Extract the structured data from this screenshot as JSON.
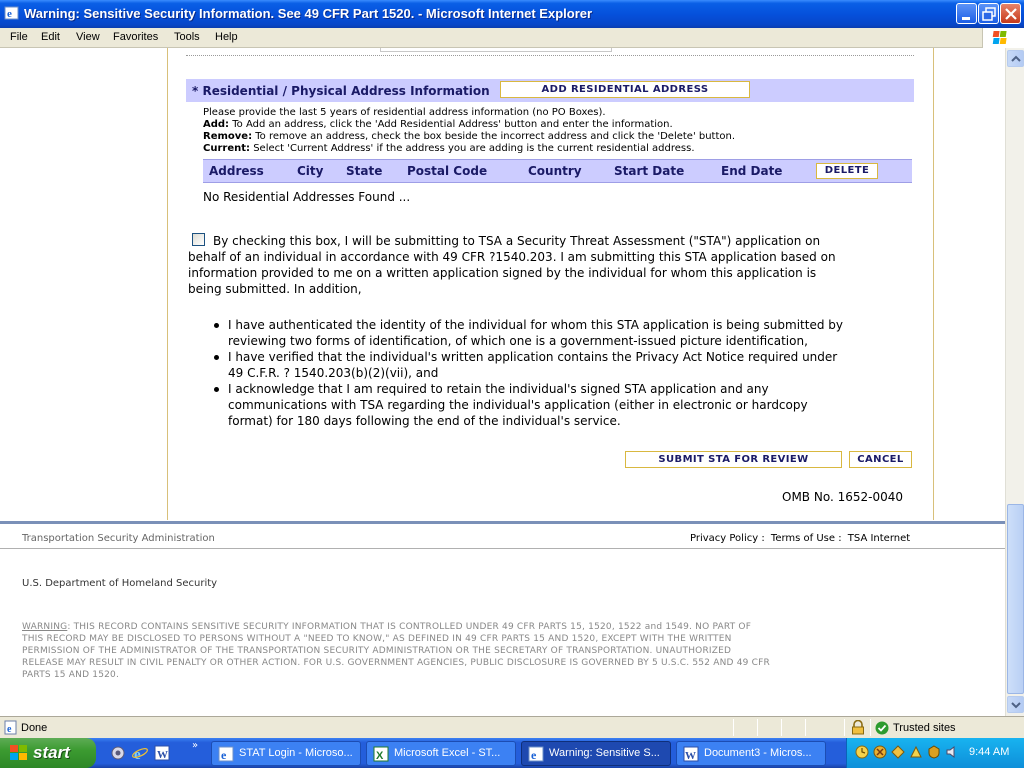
{
  "window": {
    "title": "Warning: Sensitive Security Information. See 49 CFR Part 1520. - Microsoft Internet Explorer"
  },
  "menu": [
    "File",
    "Edit",
    "View",
    "Favorites",
    "Tools",
    "Help"
  ],
  "section": {
    "title": "* Residential / Physical Address Information",
    "add_button": "ADD RESIDENTIAL ADDRESS"
  },
  "instructions": {
    "intro": "Please provide the last 5 years of residential address information (no PO Boxes).",
    "add_label": "Add:",
    "add_text": " To Add an address, click the 'Add Residential Address' button and enter the information.",
    "remove_label": "Remove:",
    "remove_text": " To remove an address, check the box beside the incorrect address and click the 'Delete' button.",
    "current_label": "Current:",
    "current_text": " Select 'Current Address' if the address you are adding is the current residential address."
  },
  "table": {
    "columns": [
      "Address",
      "City",
      "State",
      "Postal Code",
      "Country",
      "Start Date",
      "End Date"
    ],
    "delete_button": "DELETE",
    "empty_text": "No Residential Addresses Found ..."
  },
  "certification": {
    "lines": [
      "By checking this box, I will be submitting to TSA a Security Threat Assessment (\"STA\") application on",
      "behalf of an individual in accordance with 49 CFR ?1540.203. I am submitting this STA application based on",
      "information provided to me on a written application signed by the individual for whom this application is",
      "being submitted. In addition,"
    ],
    "bullets": [
      [
        "I have authenticated the identity of the individual for whom this STA application is being submitted by",
        "reviewing two forms of identification, of which one is a government-issued picture identification,"
      ],
      [
        "I have verified that the individual's written application contains the Privacy Act Notice required under",
        "49 C.F.R. ? 1540.203(b)(2)(vii), and"
      ],
      [
        "I acknowledge that I am required to retain the individual's signed STA application and any",
        "communications with TSA regarding the individual's application (either in electronic or hardcopy",
        "format) for 180 days following the end of the individual's service."
      ]
    ]
  },
  "actions": {
    "submit": "SUBMIT STA FOR REVIEW",
    "cancel": "CANCEL"
  },
  "omb": "OMB No. 1652-0040",
  "footer": {
    "agency": "Transportation Security Administration",
    "links": [
      "Privacy Policy",
      "Terms of Use",
      "TSA Internet"
    ],
    "separator": ":",
    "department": "U.S. Department of Homeland Security",
    "warning_label": "WARNING",
    "warning_lines": [
      ": THIS RECORD CONTAINS SENSITIVE SECURITY INFORMATION THAT IS CONTROLLED UNDER 49 CFR PARTS 15, 1520, 1522 and 1549. NO PART OF",
      "THIS RECORD MAY BE DISCLOSED TO PERSONS WITHOUT A \"NEED TO KNOW,\" AS DEFINED IN 49 CFR PARTS 15 AND 1520, EXCEPT WITH THE WRITTEN",
      "PERMISSION OF THE ADMINISTRATOR OF THE TRANSPORTATION SECURITY ADMINISTRATION OR THE SECRETARY OF TRANSPORTATION. UNAUTHORIZED",
      "RELEASE MAY RESULT IN CIVIL PENALTY OR OTHER ACTION. FOR U.S. GOVERNMENT AGENCIES, PUBLIC DISCLOSURE IS GOVERNED BY 5 U.S.C. 552 AND 49 CFR",
      "PARTS 15 AND 1520."
    ]
  },
  "status": {
    "text": "Done",
    "zone": "Trusted sites"
  },
  "taskbar": {
    "start": "start",
    "tasks": [
      {
        "label": "STAT Login - Microso...",
        "icon": "ie-icon",
        "active": false
      },
      {
        "label": "Microsoft Excel - ST...",
        "icon": "excel-icon",
        "active": false
      },
      {
        "label": "Warning: Sensitive S...",
        "icon": "ie-icon",
        "active": true
      },
      {
        "label": "Document3 - Micros...",
        "icon": "word-icon",
        "active": false
      }
    ],
    "clock": "9:44 AM"
  },
  "colors": {
    "header_band": "#ccccff",
    "header_text": "#1a1a66",
    "button_border": "#d9b840",
    "title_bar": "#0551dc",
    "taskbar": "#245edb",
    "start_button": "#3c9b31"
  }
}
